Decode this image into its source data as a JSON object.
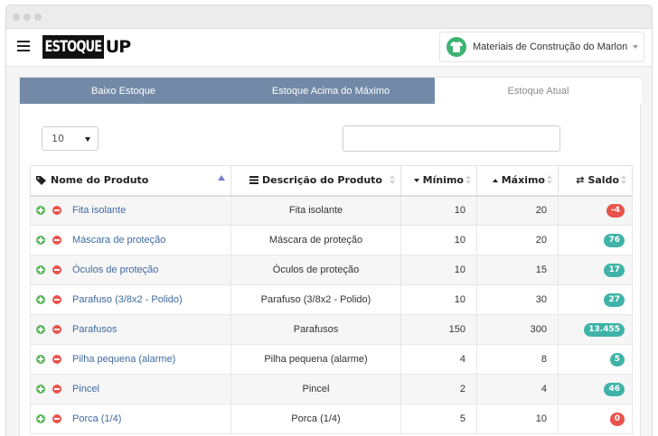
{
  "app": {
    "logo_main": "ESTOQUE",
    "logo_suffix": "UP"
  },
  "header": {
    "store_name": "Materiais de Construção do Marlon",
    "store_icon": "shirt-icon"
  },
  "tabs": [
    {
      "label": "Baixo Estoque",
      "active": false
    },
    {
      "label": "Estoque Acima do Máximo",
      "active": false
    },
    {
      "label": "Estoque Atual",
      "active": true
    }
  ],
  "controls": {
    "page_size": "10",
    "search_value": ""
  },
  "table": {
    "columns": {
      "name": "Nome do Produto",
      "desc": "Descrição do Produto",
      "min": "Mínimo",
      "max": "Máximo",
      "saldo": "Saldo"
    },
    "rows": [
      {
        "name": "Fita isolante",
        "desc": "Fita isolante",
        "min": "10",
        "max": "20",
        "saldo": "-4",
        "saldo_color": "#e9534b"
      },
      {
        "name": "Máscara de proteção",
        "desc": "Máscara de proteção",
        "min": "10",
        "max": "20",
        "saldo": "76",
        "saldo_color": "#3fb3a7"
      },
      {
        "name": "Óculos de proteção",
        "desc": "Óculos de proteção",
        "min": "10",
        "max": "15",
        "saldo": "17",
        "saldo_color": "#3fb3a7"
      },
      {
        "name": "Parafuso (3/8x2 - Polido)",
        "desc": "Parafuso (3/8x2 - Polido)",
        "min": "10",
        "max": "30",
        "saldo": "27",
        "saldo_color": "#3fb3a7"
      },
      {
        "name": "Parafusos",
        "desc": "Parafusos",
        "min": "150",
        "max": "300",
        "saldo": "13.455",
        "saldo_color": "#3fb3a7"
      },
      {
        "name": "Pilha pequena (alarme)",
        "desc": "Pilha pequena (alarme)",
        "min": "4",
        "max": "8",
        "saldo": "5",
        "saldo_color": "#3fb3a7"
      },
      {
        "name": "Pincel",
        "desc": "Pincel",
        "min": "2",
        "max": "4",
        "saldo": "46",
        "saldo_color": "#3fb3a7"
      },
      {
        "name": "Porca (1/4)",
        "desc": "Porca (1/4)",
        "min": "5",
        "max": "10",
        "saldo": "0",
        "saldo_color": "#e9534b"
      }
    ]
  },
  "colors": {
    "tab_dark": "#728aa7",
    "link": "#3f6aa0",
    "badge_ok": "#3fb3a7",
    "badge_alert": "#e9534b"
  }
}
